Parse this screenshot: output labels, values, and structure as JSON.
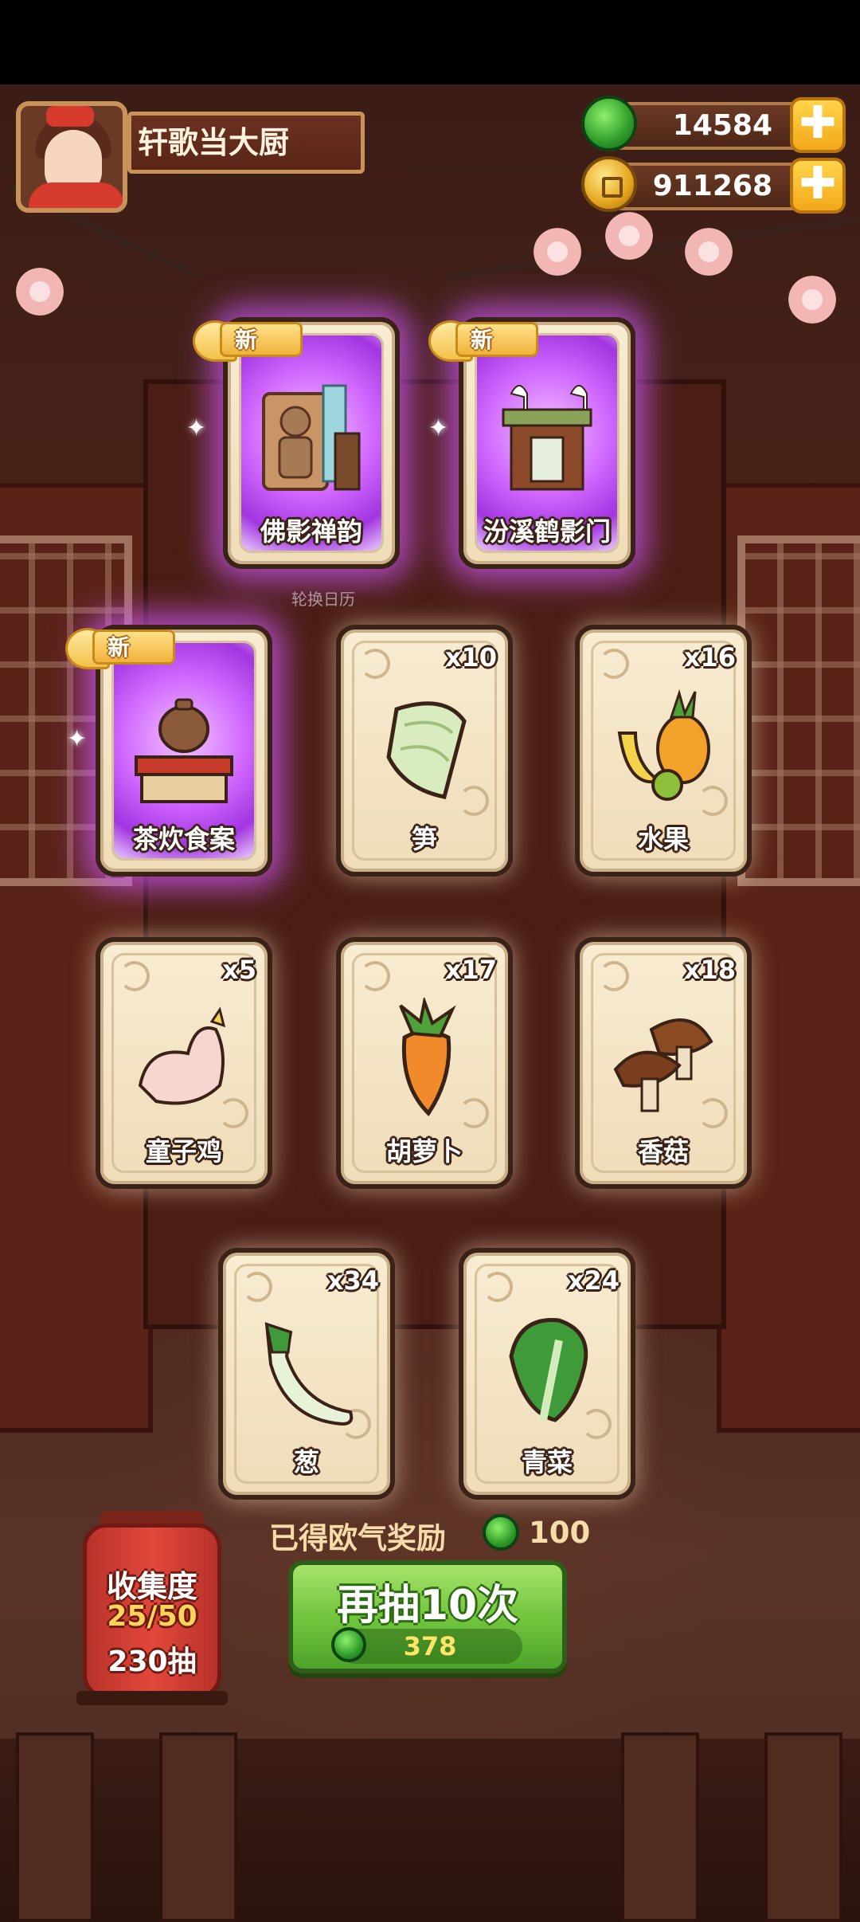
{
  "player": {
    "name": "轩歌当大厨"
  },
  "currencies": {
    "jade": {
      "value": "14584",
      "icon": "jade-icon",
      "plus": "✚"
    },
    "coin": {
      "value": "911268",
      "icon": "coin-icon",
      "plus": "✚"
    }
  },
  "background_label": "轮换日历",
  "new_badge": "新",
  "cards": [
    {
      "name": "佛影禅韵",
      "qty": "",
      "is_new": true,
      "art": "buddha-statue-icon"
    },
    {
      "name": "汾溪鹤影门",
      "qty": "",
      "is_new": true,
      "art": "crane-gate-icon"
    },
    {
      "name": "茶炊食案",
      "qty": "",
      "is_new": true,
      "art": "teapot-table-icon"
    },
    {
      "name": "笋",
      "qty": "x10",
      "is_new": false,
      "art": "bamboo-shoot-icon"
    },
    {
      "name": "水果",
      "qty": "x16",
      "is_new": false,
      "art": "fruit-icon"
    },
    {
      "name": "童子鸡",
      "qty": "x5",
      "is_new": false,
      "art": "chicken-icon"
    },
    {
      "name": "胡萝卜",
      "qty": "x17",
      "is_new": false,
      "art": "carrot-icon"
    },
    {
      "name": "香菇",
      "qty": "x18",
      "is_new": false,
      "art": "mushroom-icon"
    },
    {
      "name": "葱",
      "qty": "x34",
      "is_new": false,
      "art": "scallion-icon"
    },
    {
      "name": "青菜",
      "qty": "x24",
      "is_new": false,
      "art": "bok-choy-icon"
    }
  ],
  "reward": {
    "label": "已得欧气奖励",
    "amount": "100"
  },
  "draw_button": {
    "label": "再抽10次",
    "cost": "378"
  },
  "collection": {
    "label": "收集度",
    "progress": "25/50",
    "draws": "230抽"
  },
  "colors": {
    "accent_green": "#6fc23c",
    "new_glow": "#d066ff",
    "card_bg": "#f8ecd2"
  }
}
